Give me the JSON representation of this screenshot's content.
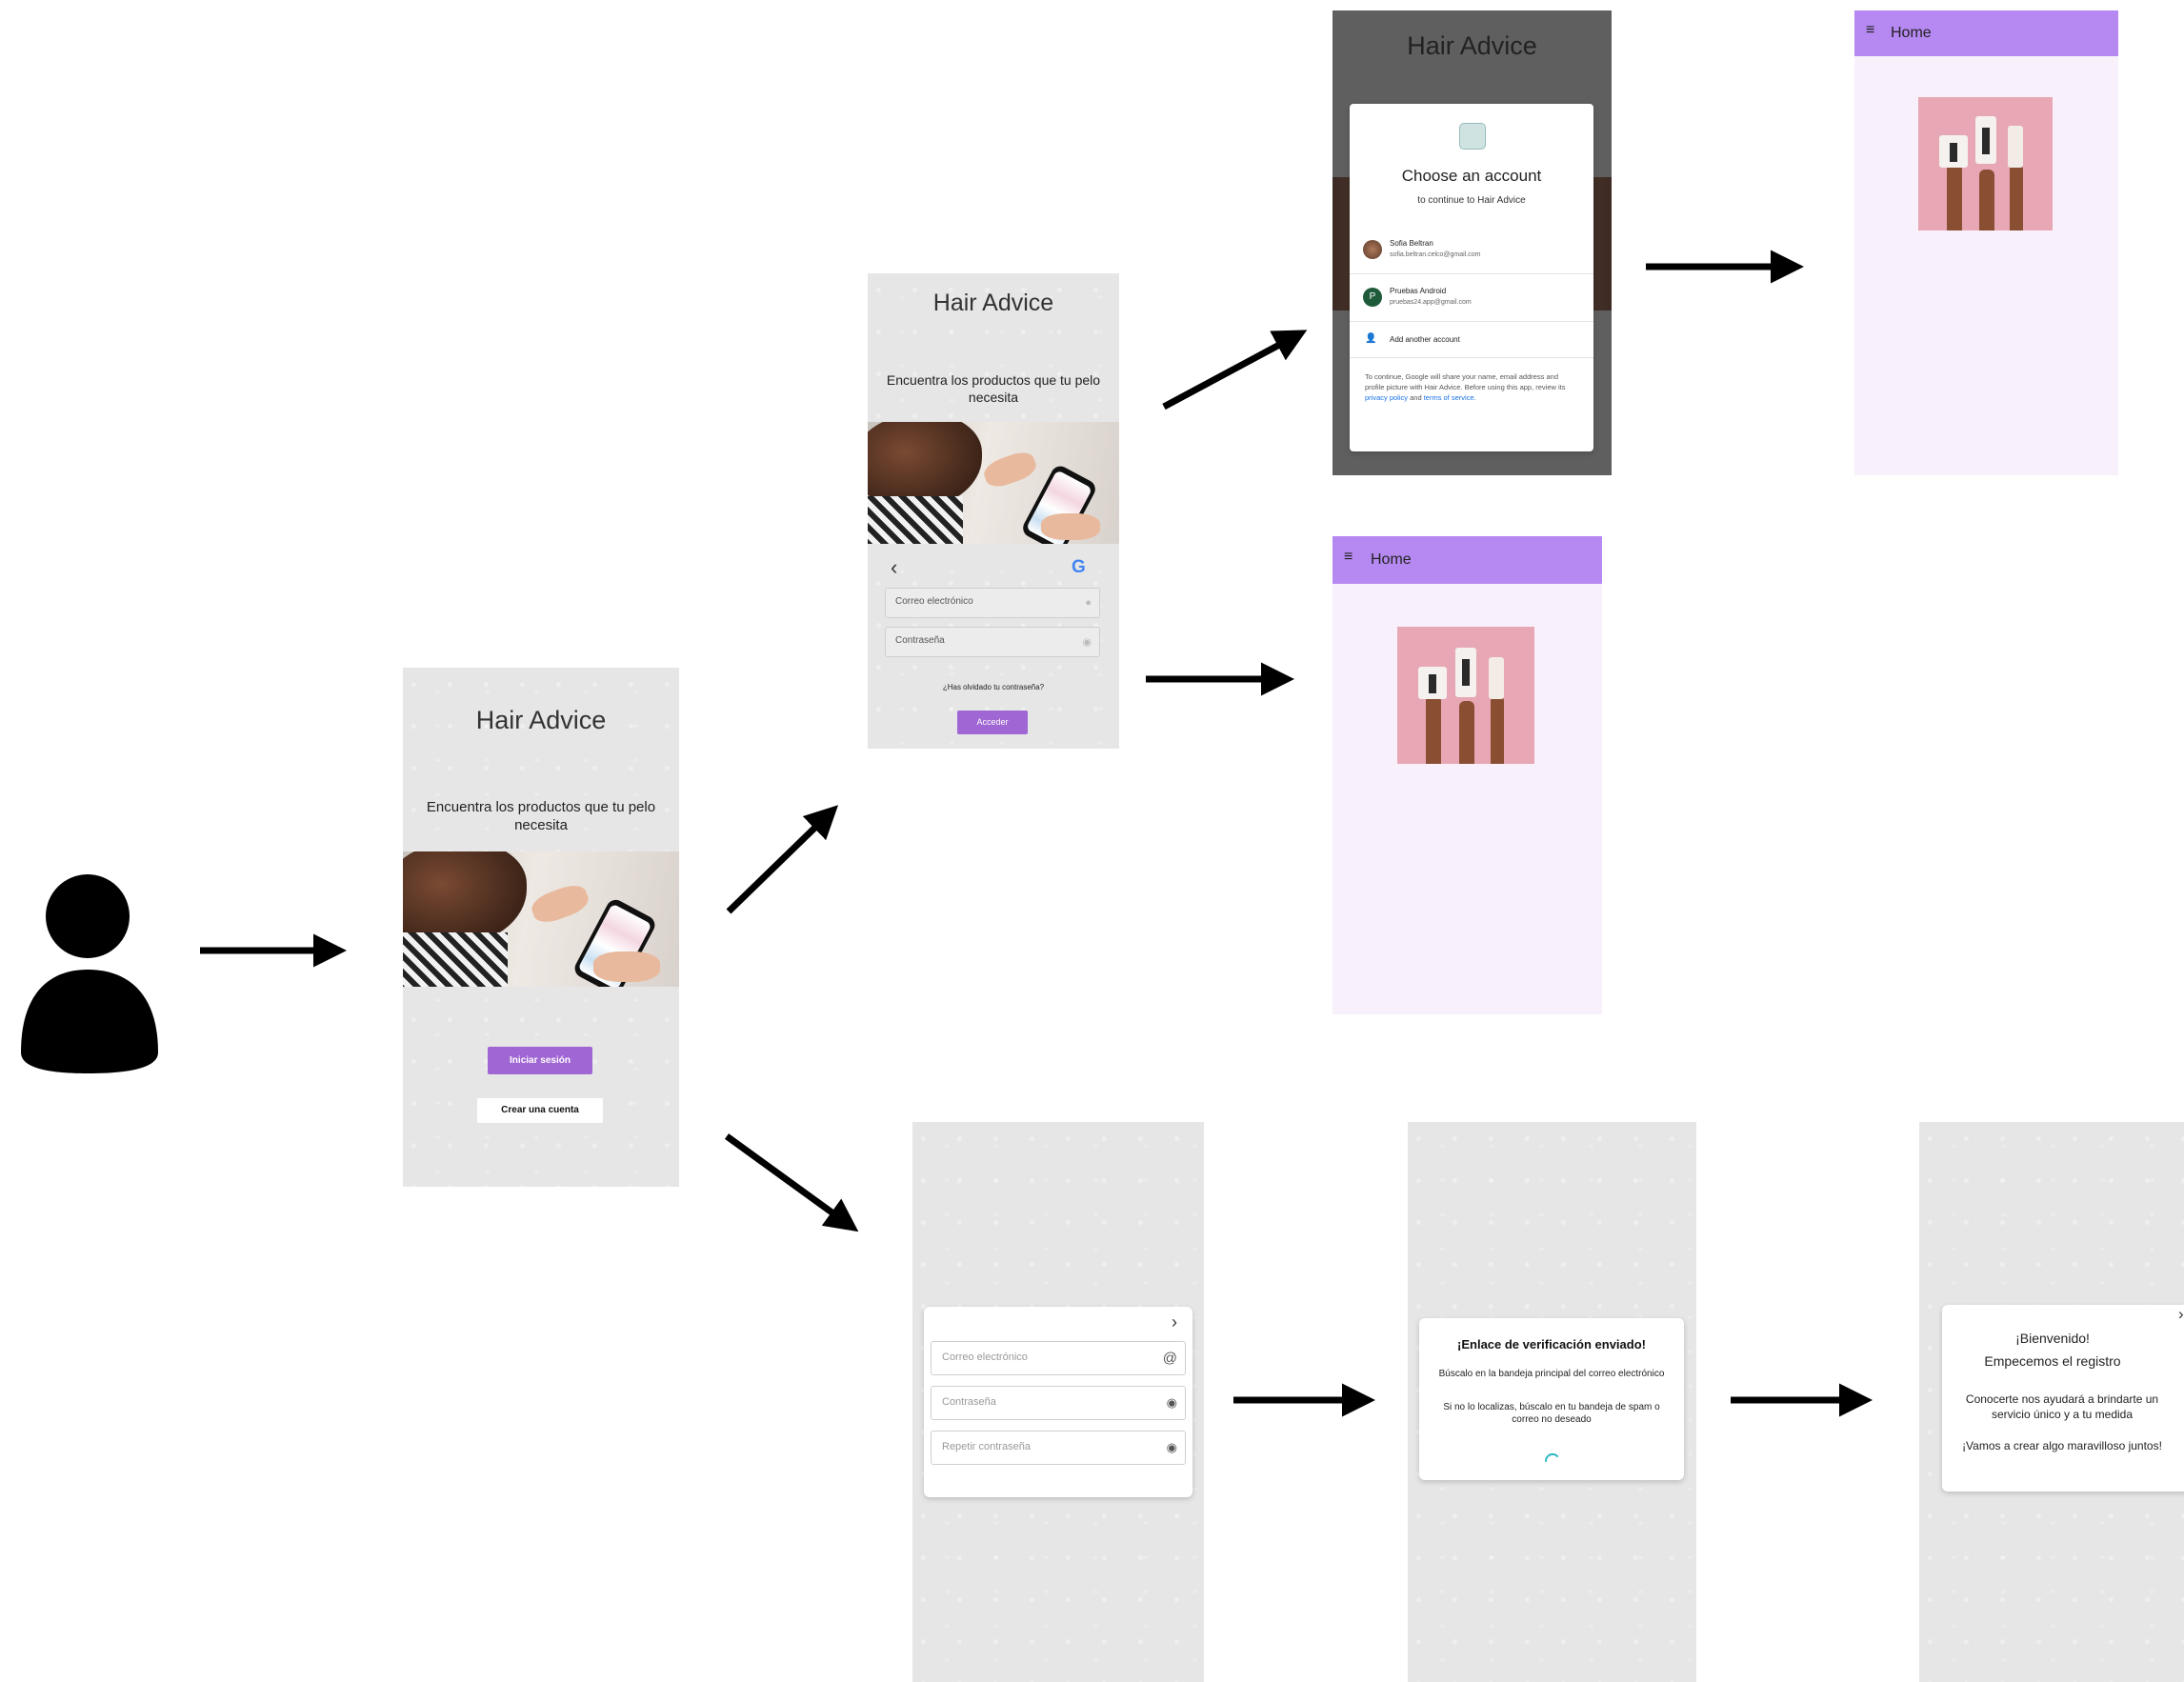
{
  "app_title": "Hair Advice",
  "tagline": "Encuentra los productos que tu pelo necesita",
  "welcome": {
    "login_button": "Iniciar sesión",
    "create_account_button": "Crear una cuenta"
  },
  "login": {
    "back_glyph": "‹",
    "google_glyph": "G",
    "email_placeholder": "Correo electrónico",
    "password_placeholder": "Contraseña",
    "forgot_password": "¿Has olvidado tu contraseña?",
    "submit_button": "Acceder"
  },
  "google_dialog": {
    "title": "Choose an account",
    "subtitle": "to continue to Hair Advice",
    "accounts": [
      {
        "name": "Sofia Beltran",
        "email": "sofia.beltran.celco@gmail.com",
        "avatar": "photo"
      },
      {
        "name": "Pruebas Android",
        "email": "pruebas24.app@gmail.com",
        "avatar": "P"
      }
    ],
    "add_account": "Add another account",
    "disclaimer": "To continue, Google will share your name, email address and profile picture with Hair Advice. Before using this app, review its",
    "privacy_link": "privacy policy",
    "and": "and",
    "terms_link": "terms of service."
  },
  "home": {
    "menu_glyph": "≡",
    "title": "Home"
  },
  "register": {
    "next_glyph": "›",
    "email_placeholder": "Correo electrónico",
    "password_placeholder": "Contraseña",
    "repeat_password_placeholder": "Repetir contraseña"
  },
  "verification": {
    "title": "¡Enlace de verificación enviado!",
    "line1": "Búscalo en la bandeja principal del correo electrónico",
    "line2": "Si no lo localizas, búscalo en tu bandeja de spam o correo no deseado"
  },
  "onboarding": {
    "next_glyph": "›",
    "welcome": "¡Bienvenido!",
    "start": "Empecemos el registro",
    "text1": "Conocerte nos ayudará a brindarte un servicio único y a tu medida",
    "text2": "¡Vamos a crear algo maravilloso juntos!"
  },
  "colors": {
    "accent_purple": "#a066d3",
    "appbar_purple": "#b589f1",
    "home_background": "#f8f1fc",
    "screen_gray": "#e6e6e6",
    "google_green_avatar": "#1e5b3a",
    "link_blue": "#1a73e8"
  },
  "icons": [
    "user-icon",
    "google-icon",
    "eye-icon",
    "at-icon",
    "menu-icon",
    "back-icon",
    "chevron-right-icon",
    "add-account-icon",
    "spinner-icon"
  ]
}
